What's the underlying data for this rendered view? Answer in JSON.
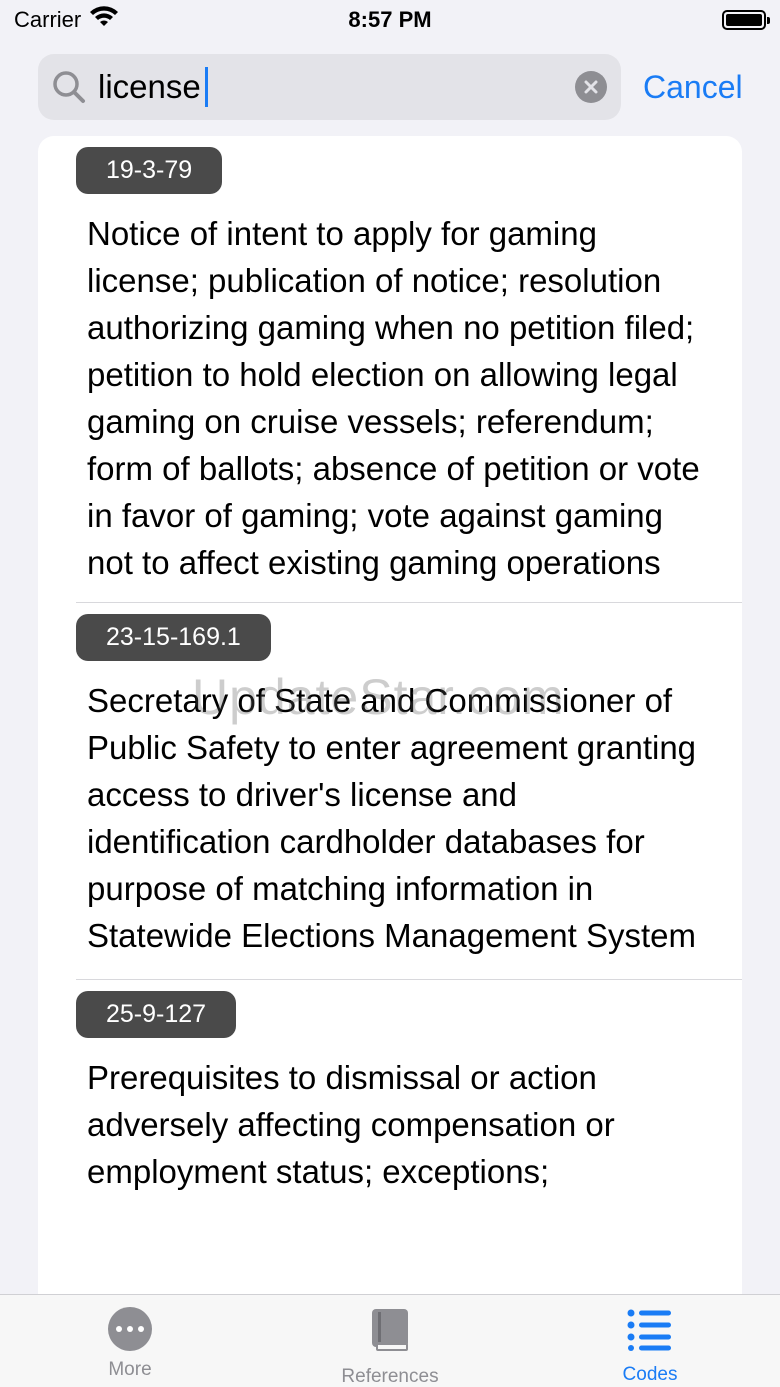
{
  "status_bar": {
    "carrier": "Carrier",
    "time": "8:57 PM"
  },
  "search": {
    "value": "license",
    "cancel_label": "Cancel"
  },
  "results": [
    {
      "code": "19-3-79",
      "title": "Notice of intent to apply for gaming license; publication of notice; resolution authorizing gaming when no petition filed; petition to hold election on allowing legal gaming on cruise vessels; referendum; form of ballots; absence of petition or vote in favor of gaming; vote against gaming not to affect existing gaming operations"
    },
    {
      "code": "23-15-169.1",
      "title": "Secretary of State and Commissioner of Public Safety to enter agreement granting access to driver's license and identification cardholder databases for purpose of matching information in Statewide Elections Management System"
    },
    {
      "code": "25-9-127",
      "title": "Prerequisites to dismissal or action adversely affecting compensation or employment status; exceptions;"
    }
  ],
  "watermark": "UpdateStar.com",
  "tab_bar": {
    "tabs": [
      {
        "label": "More",
        "icon": "more-icon",
        "active": false
      },
      {
        "label": "References",
        "icon": "book-icon",
        "active": false
      },
      {
        "label": "Codes",
        "icon": "list-icon",
        "active": true
      }
    ]
  },
  "colors": {
    "accent": "#1a7cf5",
    "badge": "#4a4a4a",
    "inactive": "#8e8e93"
  }
}
